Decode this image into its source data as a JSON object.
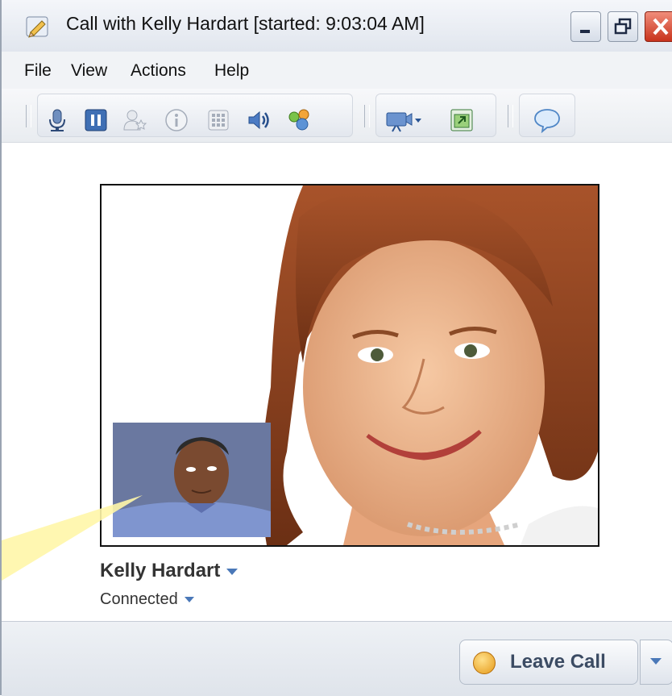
{
  "window": {
    "title": "Call with Kelly Hardart [started: 9:03:04 AM]",
    "app_icon": "pencil-icon",
    "controls": [
      "minimize-icon",
      "restore-icon",
      "close-icon"
    ]
  },
  "menubar": {
    "items": [
      {
        "label": "File"
      },
      {
        "label": "View"
      },
      {
        "label": "Actions"
      },
      {
        "label": "Help"
      }
    ]
  },
  "toolbar": {
    "icons": [
      "microphone-icon",
      "pause-icon",
      "add-person-icon",
      "info-icon",
      "dialpad-icon",
      "speaker-icon",
      "participants-icon",
      "video-camera-icon",
      "share-window-icon",
      "chat-icon"
    ]
  },
  "call": {
    "caller_name": "Kelly Hardart",
    "status": "Connected"
  },
  "footer": {
    "leave_call_label": "Leave Call"
  },
  "colors": {
    "accent": "#4a78b8",
    "close_button": "#c8331c",
    "callout": "#fff6a8"
  }
}
